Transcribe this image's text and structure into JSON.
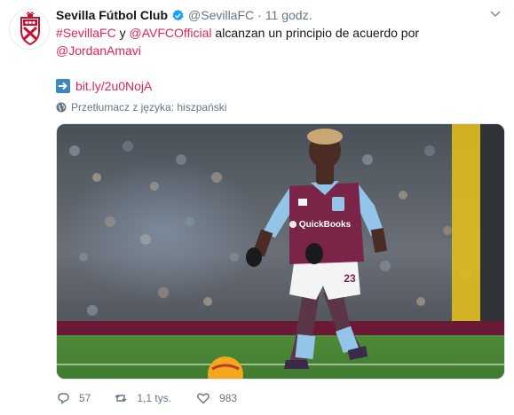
{
  "tweet": {
    "author_name": "Sevilla Fútbol Club",
    "handle": "@SevillaFC",
    "separator": "·",
    "timestamp": "11 godz.",
    "text": {
      "hashtag": "#SevillaFC",
      "word_y": " y ",
      "mention1": "@AVFCOfficial",
      "body": " alcanzan un principio de acuerdo por",
      "mention2": "@JordanAmavi",
      "url": "bit.ly/2u0NojA"
    },
    "translate_label": "Przetłumacz z języka: hiszpański",
    "stats": {
      "replies": "57",
      "retweets": "1,1 tys.",
      "likes": "983"
    }
  },
  "media": {
    "sponsor_text": "QuickBooks",
    "shirt_number": "23"
  },
  "colors": {
    "link": "#e0245e",
    "muted": "#657786",
    "verified": "#1da1f2",
    "claret": "#7a2447",
    "sky_blue": "#93c5e8"
  },
  "icons": [
    "sevilla-crest-icon",
    "verified-icon",
    "chevron-down-icon",
    "arrow-right-icon",
    "globe-icon",
    "reply-icon",
    "retweet-icon",
    "heart-icon"
  ]
}
